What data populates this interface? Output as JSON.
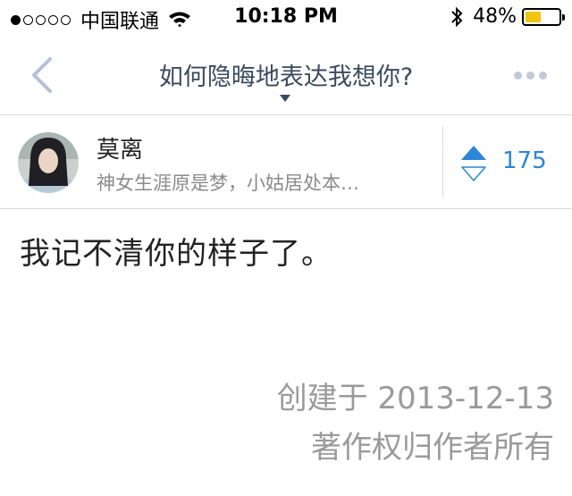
{
  "status_bar": {
    "signal_bars_filled": 1,
    "signal_bars_total": 5,
    "carrier": "中国联通",
    "time": "10:18 PM",
    "battery_text": "48%",
    "battery_level": 0.48,
    "battery_color": "#f2c40f"
  },
  "nav": {
    "title": "如何隐晦地表达我想你?",
    "back_icon": "chevron-left-icon",
    "more_icon": "more-dots-icon"
  },
  "author": {
    "name": "莫离",
    "bio": "神女生涯原是梦，小姑居处本…",
    "vote_count": "175",
    "accent": "#2a86d7"
  },
  "answer": {
    "text": "我记不清你的样子了。"
  },
  "meta": {
    "created": "创建于 2013-12-13",
    "copyright": "著作权归作者所有"
  }
}
